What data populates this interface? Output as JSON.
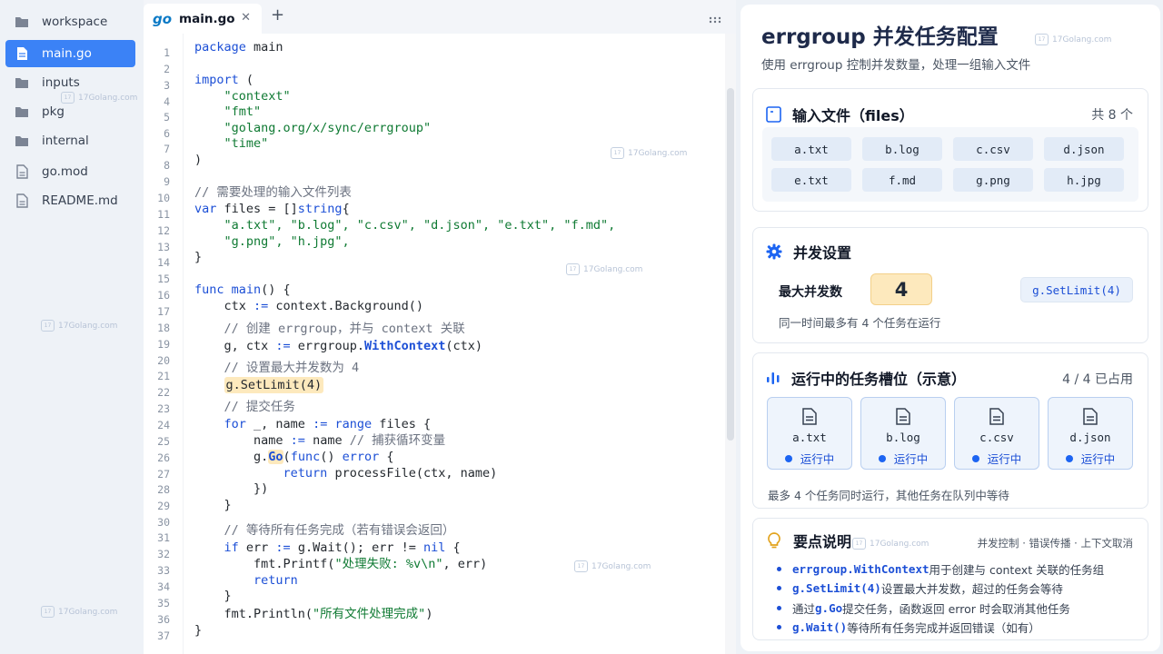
{
  "sidebar": {
    "items": [
      {
        "label": "workspace",
        "icon": "folder-icon",
        "active": false
      },
      {
        "label": "main.go",
        "icon": "file-icon",
        "active": true
      },
      {
        "label": "inputs",
        "icon": "folder-icon",
        "active": false
      },
      {
        "label": "pkg",
        "icon": "folder-icon",
        "active": false
      },
      {
        "label": "internal",
        "icon": "folder-icon",
        "active": false
      },
      {
        "label": "go.mod",
        "icon": "file-icon",
        "active": false
      },
      {
        "label": "README.md",
        "icon": "file-icon",
        "active": false
      }
    ]
  },
  "editor": {
    "tab": {
      "logo": "go",
      "name": "main.go",
      "close": "✕"
    },
    "add_tab": "+",
    "line_numbers": [
      "1",
      "2",
      "3",
      "4",
      "5",
      "6",
      "7",
      "8",
      "9",
      "10",
      "11",
      "12",
      "13",
      "14",
      "15",
      "16",
      "17",
      "18",
      "19",
      "20",
      "21",
      "22",
      "23",
      "24",
      "25",
      "26",
      "27",
      "28",
      "29",
      "30",
      "31",
      "32",
      "33",
      "34",
      "35",
      "36",
      "37"
    ],
    "code": {
      "l1_kw": "package",
      "l1_rest": " main",
      "l3_kw": "import",
      "l3_rest": " (",
      "l4": "    \"context\"",
      "l5": "    \"fmt\"",
      "l6": "    \"golang.org/x/sync/errgroup\"",
      "l7": "    \"time\"",
      "l8": ")",
      "l10": "// 需要处理的输入文件列表",
      "l11_kw": "var",
      "l11_mid": " files = []",
      "l11_type": "string",
      "l11_end": "{",
      "l12": "    \"a.txt\", \"b.log\", \"c.csv\", \"d.json\", \"e.txt\", \"f.md\",",
      "l13": "    \"g.png\", \"h.jpg\",",
      "l14": "}",
      "l16_kw": "func",
      "l16_fn": " main",
      "l16_end": "() {",
      "l17_a": "    ctx ",
      "l17_op": ":=",
      "l17_b": " context.Background()",
      "l18": "    // 创建 errgroup，并与 context 关联",
      "l19_a": "    g, ctx ",
      "l19_op": ":=",
      "l19_b": " errgroup.",
      "l19_fn": "WithContext",
      "l19_c": "(ctx)",
      "l21": "    // 设置最大并发数为 4",
      "l22_pre": "    ",
      "l22_hl": "g.SetLimit(4)",
      "l23": "    // 提交任务",
      "l24_kw": "    for",
      "l24_a": " _, name ",
      "l24_op": ":=",
      "l24_kw2": " range",
      "l24_b": " files {",
      "l25_a": "        name ",
      "l25_op": ":=",
      "l25_b": " name ",
      "l25_cm": "// 捕获循环变量",
      "l26_a": "        g.",
      "l26_fn": "Go",
      "l26_b": "(",
      "l26_kw": "func",
      "l26_c": "() ",
      "l26_kw2": "error",
      "l26_d": " {",
      "l27_kw": "            return",
      "l27_b": " processFile(ctx, name)",
      "l28": "        })",
      "l29": "    }",
      "l31": "    // 等待所有任务完成（若有错误会返回）",
      "l32_kw": "    if",
      "l32_a": " err ",
      "l32_op": ":=",
      "l32_b": " g.Wait(); err != ",
      "l32_kw2": "nil",
      "l32_c": " {",
      "l33_a": "        fmt.Printf(",
      "l33_str": "\"处理失败: %v\\n\"",
      "l33_b": ", err)",
      "l34_kw": "        return",
      "l35": "    }",
      "l36_a": "    fmt.Println(",
      "l36_str": "\"所有文件处理完成\"",
      "l36_b": ")",
      "l37": "}"
    }
  },
  "panel": {
    "title": "errgroup 并发任务配置",
    "subtitle": "使用 errgroup 控制并发数量，处理一组输入文件",
    "files_card": {
      "title": "输入文件（files）",
      "count": "共 8 个",
      "files": [
        "a.txt",
        "b.log",
        "c.csv",
        "d.json",
        "e.txt",
        "f.md",
        "g.png",
        "h.jpg"
      ]
    },
    "concurrency_card": {
      "title": "并发设置",
      "max_label": "最大并发数",
      "max_value": "4",
      "code": "g.SetLimit(4)",
      "note": "同一时间最多有 4 个任务在运行"
    },
    "slots_card": {
      "title": "运行中的任务槽位（示意）",
      "occupied": "4 / 4 已占用",
      "slots": [
        {
          "name": "a.txt",
          "status": "运行中"
        },
        {
          "name": "b.log",
          "status": "运行中"
        },
        {
          "name": "c.csv",
          "status": "运行中"
        },
        {
          "name": "d.json",
          "status": "运行中"
        }
      ],
      "note": "最多 4 个任务同时运行，其他任务在队列中等待"
    },
    "notes_card": {
      "title": "要点说明",
      "tags": "并发控制 · 错误传播 · 上下文取消",
      "b1_code": "errgroup.WithContext",
      "b1_text": " 用于创建与 context 关联的任务组",
      "b2_code": "g.SetLimit(4)",
      "b2_text": " 设置最大并发数，超过的任务会等待",
      "b3_pre": "通过 ",
      "b3_code": "g.Go",
      "b3_text": " 提交任务，函数返回 error 时会取消其他任务",
      "b4_code": "g.Wait()",
      "b4_text": " 等待所有任务完成并返回错误（如有）"
    }
  },
  "watermark": "17Golang.com",
  "colors": {
    "accent": "#3b82f6",
    "keyword": "#1c4fd6",
    "string": "#0f7a33",
    "highlight": "#fde9bd"
  }
}
